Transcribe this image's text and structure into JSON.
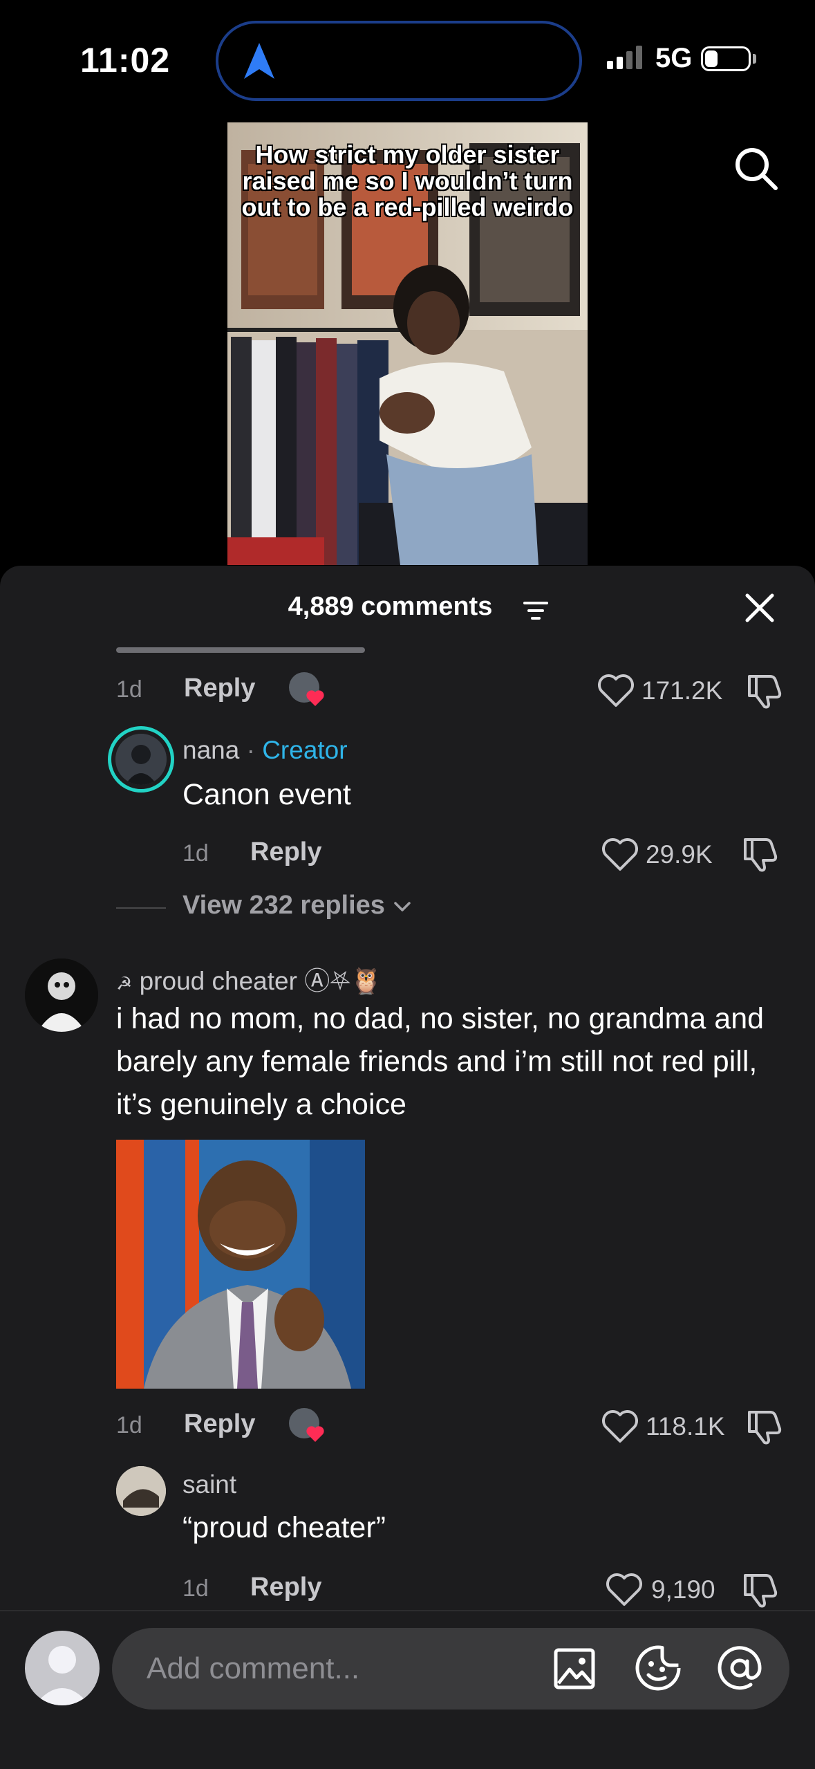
{
  "status_bar": {
    "time": "11:02",
    "network": "5G"
  },
  "video": {
    "caption": "How strict my older sister raised me so I wouldn’t turn out to be a red-pilled weirdo"
  },
  "comments_sheet": {
    "title": "4,889 comments"
  },
  "comments": [
    {
      "id": "top-partial",
      "age": "1d",
      "reply_label": "Reply",
      "likes": "171.2K"
    },
    {
      "id": "nana",
      "username": "nana",
      "separator": " · ",
      "badge": "Creator",
      "text": "Canon event",
      "age": "1d",
      "reply_label": "Reply",
      "likes": "29.9K",
      "view_replies": "View 232 replies"
    },
    {
      "id": "proud-cheater",
      "username_prefix": "☭",
      "username": "proud cheater",
      "username_suffix": "Ⓐ⛧🦉",
      "text": "i had no mom, no dad, no sister, no grandma and barely any female friends and i’m still not red pill, it’s genuinely a choice",
      "age": "1d",
      "reply_label": "Reply",
      "likes": "118.1K"
    },
    {
      "id": "saint",
      "username": "saint",
      "text": "“proud cheater”",
      "age": "1d",
      "reply_label": "Reply",
      "likes": "9,190"
    }
  ],
  "composer": {
    "placeholder": "Add comment..."
  },
  "icons": {
    "search": "search-icon",
    "close": "close-icon",
    "filter": "filter-icon",
    "heart": "heart-icon",
    "dislike": "thumbs-down-icon",
    "image": "image-icon",
    "emoji": "emoji-icon",
    "mention": "at-icon"
  },
  "colors": {
    "creator_badge": "#2fb4e8",
    "sheet_bg": "#1c1c1e",
    "liked_heart": "#fe2c55"
  }
}
